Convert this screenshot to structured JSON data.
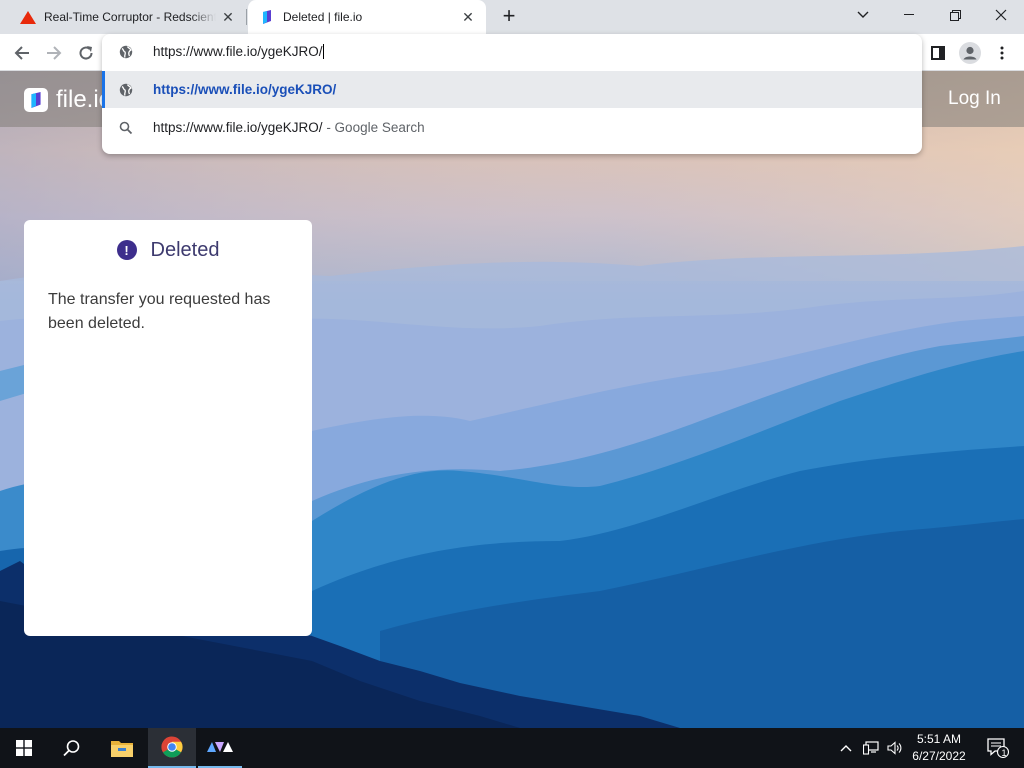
{
  "browser": {
    "tabs": [
      {
        "title": "Real-Time Corruptor - Redscientist",
        "active": false,
        "favicon": "warning-triangle-icon"
      },
      {
        "title": "Deleted | file.io",
        "active": true,
        "favicon": "fileio-icon"
      }
    ],
    "new_tab_label": "+",
    "omnibox": {
      "value": "https://www.file.io/ygeKJRO/",
      "suggestions": [
        {
          "text": "https://www.file.io/ygeKJRO/",
          "icon": "globe-icon",
          "selected": true
        },
        {
          "text": "https://www.file.io/ygeKJRO/",
          "suffix": " - Google Search",
          "icon": "search-icon",
          "selected": false
        }
      ]
    }
  },
  "site": {
    "logo_text": "file.io",
    "login_label": "Log In"
  },
  "card": {
    "title": "Deleted",
    "message": "The transfer you requested has been deleted."
  },
  "taskbar": {
    "time": "5:51 AM",
    "date": "6/27/2022",
    "notification_count": "1"
  },
  "colors": {
    "accent": "#1a73e8",
    "brand": "#3d2e8c",
    "taskbar": "#101318"
  }
}
